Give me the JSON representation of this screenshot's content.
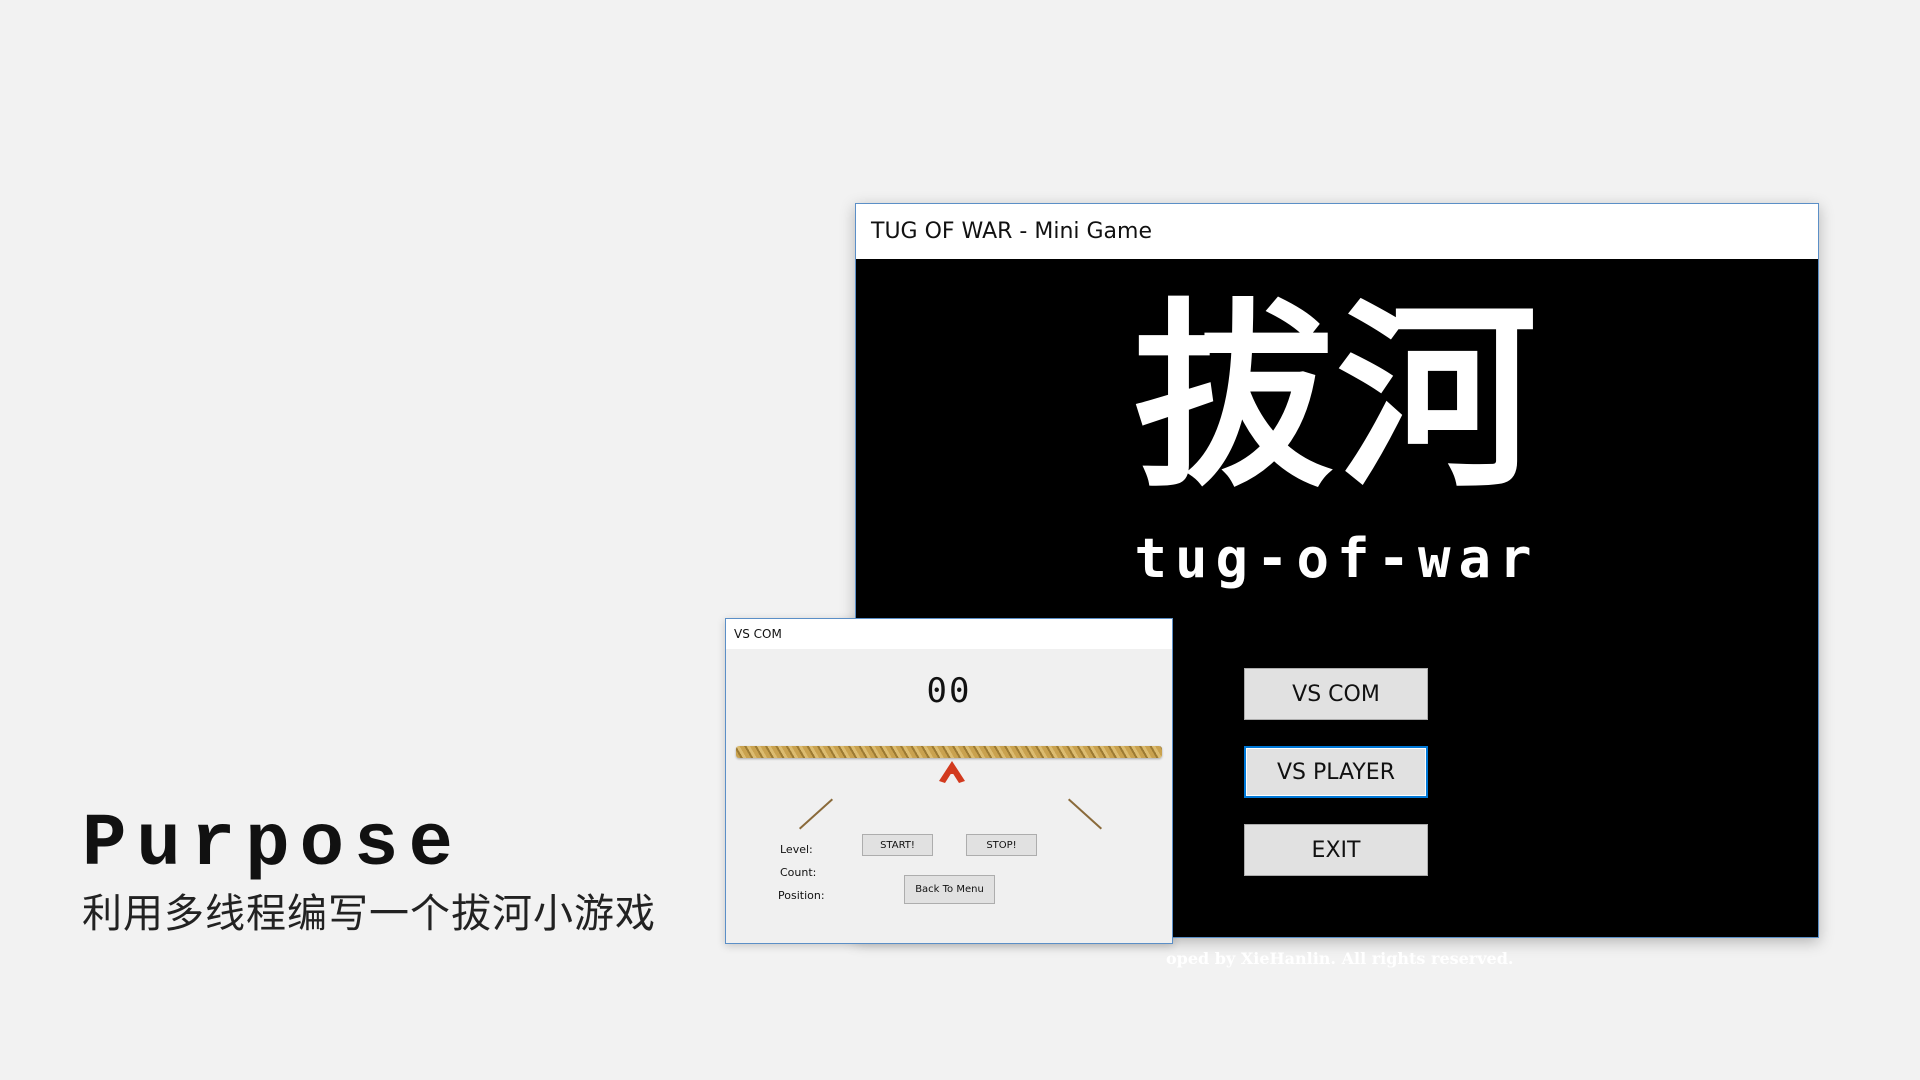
{
  "slide": {
    "purpose_title": "Purpose",
    "purpose_text": "利用多线程编写一个拔河小游戏"
  },
  "main_window": {
    "title": "TUG OF WAR - Mini Game",
    "logo_chinese": "拔河",
    "logo_english": "tug-of-war",
    "buttons": {
      "vs_com": "VS COM",
      "vs_player": "VS PLAYER",
      "exit": "EXIT"
    },
    "footer": "oped by XieHanlin. All rights reserved."
  },
  "com_window": {
    "title": "VS COM",
    "score": "00",
    "labels": {
      "level": "Level:",
      "count": "Count:",
      "position": "Position:"
    },
    "buttons": {
      "start": "START!",
      "stop": "STOP!",
      "back": "Back To Menu"
    }
  },
  "colors": {
    "background": "#f2f2f2",
    "window_border": "#5b8fc7",
    "focus_border": "#0078d7",
    "marker": "#d23a1e",
    "rope": "#c9a24f"
  }
}
